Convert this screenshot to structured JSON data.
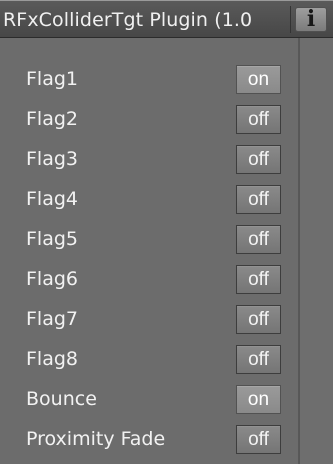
{
  "title": "RFxColliderTgt Plugin (1.0",
  "info_button": "i",
  "rows": [
    {
      "label": "Flag1",
      "value": "on"
    },
    {
      "label": "Flag2",
      "value": "off"
    },
    {
      "label": "Flag3",
      "value": "off"
    },
    {
      "label": "Flag4",
      "value": "off"
    },
    {
      "label": "Flag5",
      "value": "off"
    },
    {
      "label": "Flag6",
      "value": "off"
    },
    {
      "label": "Flag7",
      "value": "off"
    },
    {
      "label": "Flag8",
      "value": "off"
    },
    {
      "label": "Bounce",
      "value": "on"
    },
    {
      "label": "Proximity Fade",
      "value": "off"
    }
  ]
}
